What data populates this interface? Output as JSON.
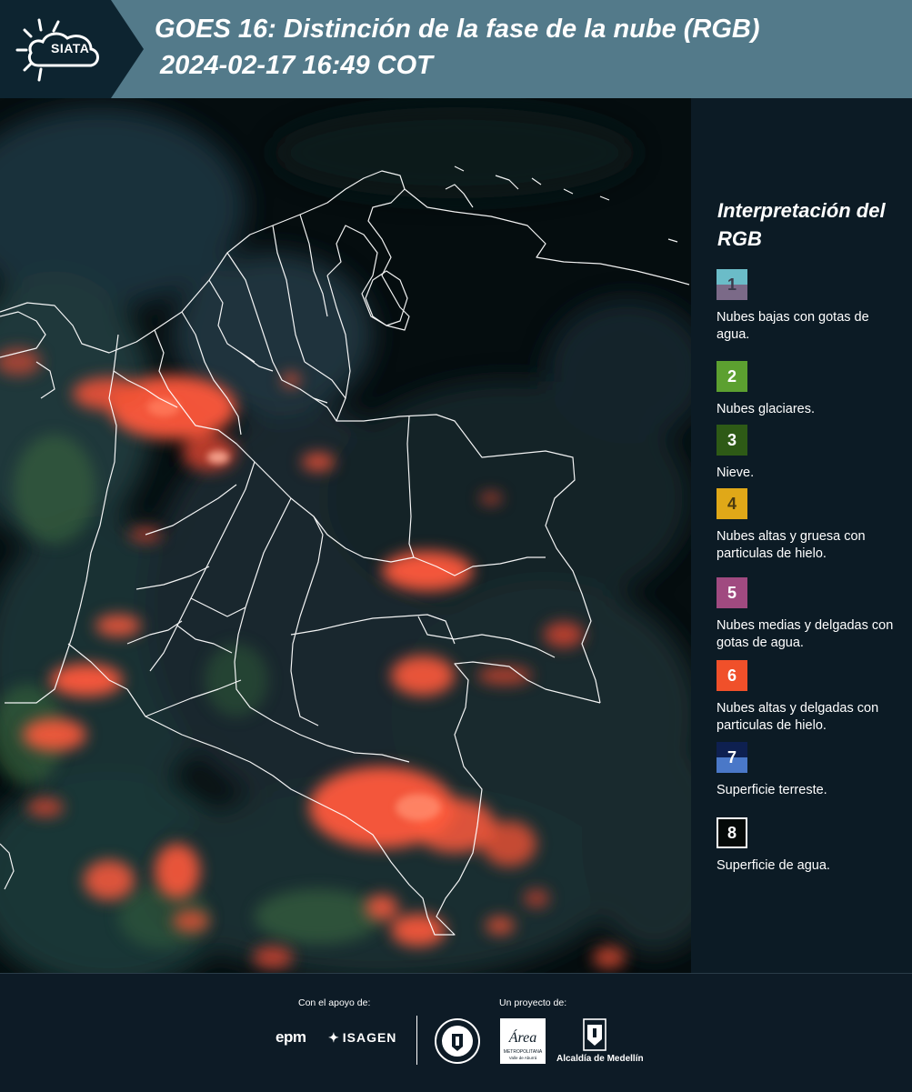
{
  "header": {
    "brand": "SIATA",
    "title": "GOES 16: Distinción de la fase de la nube (RGB)",
    "subtitle": "2024-02-17 16:49 COT"
  },
  "map": {
    "region_shown": "Colombia",
    "composite": "RGB",
    "colors": {
      "background": "#0a1418",
      "boundaries": "#ffffff",
      "ice_clouds": "#ff5a3c",
      "clear_land": "#1e2a30"
    }
  },
  "legend": {
    "title": "Interpretación del RGB",
    "items": [
      {
        "number": "1",
        "color_top": "#6bbcc8",
        "color_bottom": "#7b6a88",
        "number_color": "#3a3a4a",
        "description": "Nubes bajas con gotas de agua."
      },
      {
        "number": "2",
        "color_top": "#5ca030",
        "color_bottom": "#5ca030",
        "number_color": "#ffffff",
        "description": "Nubes glaciares."
      },
      {
        "number": "3",
        "color_top": "#2e5a16",
        "color_bottom": "#2e5a16",
        "number_color": "#ffffff",
        "description": "Nieve."
      },
      {
        "number": "4",
        "color_top": "#e0a818",
        "color_bottom": "#e0a818",
        "number_color": "#4a3a10",
        "description": "Nubes altas y gruesa con particulas de hielo."
      },
      {
        "number": "5",
        "color_top": "#a04a80",
        "color_bottom": "#a04a80",
        "number_color": "#ffffff",
        "description": "Nubes medias y delgadas con gotas de agua."
      },
      {
        "number": "6",
        "color_top": "#f0502a",
        "color_bottom": "#f0502a",
        "number_color": "#ffffff",
        "description": "Nubes altas y delgadas con particulas de hielo."
      },
      {
        "number": "7",
        "color_top": "#0e2050",
        "color_bottom": "#4a78c8",
        "number_color": "#ffffff",
        "description": "Superficie terreste."
      },
      {
        "number": "8",
        "color_top": "#050a08",
        "color_bottom": "#050a08",
        "number_color": "#ffffff",
        "description": "Superficie de agua."
      }
    ]
  },
  "footer": {
    "support_label": "Con el apoyo de:",
    "project_label": "Un proyecto de:",
    "sponsors": [
      "epm",
      "ISAGEN"
    ],
    "partners": [
      "Universidad Nacional de Colombia sede Medellín",
      "Área Metropolitana Valle de Aburrá",
      "Alcaldía de Medellín"
    ],
    "alcaldia_label": "Alcaldía de Medellín"
  }
}
